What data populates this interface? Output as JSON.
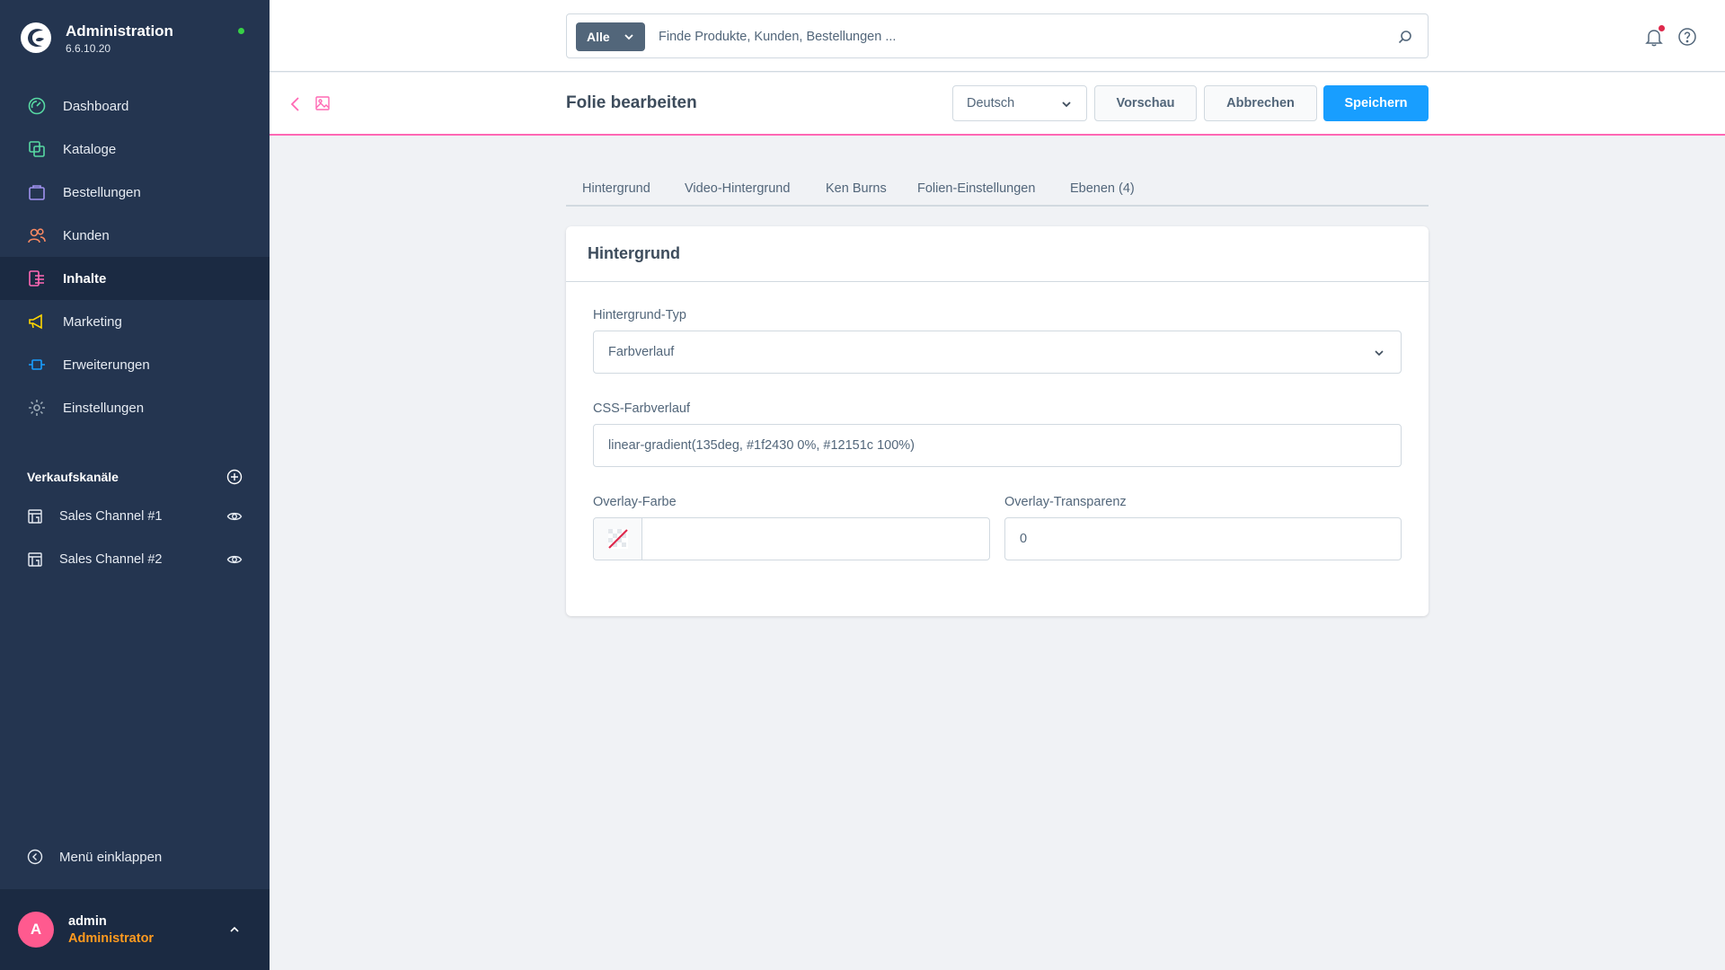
{
  "brand": {
    "title": "Administration",
    "version": "6.6.10.20",
    "status_color": "#37d046"
  },
  "sidebar": {
    "items": [
      {
        "label": "Dashboard",
        "icon": "dashboard-icon",
        "color": "#57d9a3"
      },
      {
        "label": "Kataloge",
        "icon": "catalog-icon",
        "color": "#57d9a3"
      },
      {
        "label": "Bestellungen",
        "icon": "orders-icon",
        "color": "#a092f0"
      },
      {
        "label": "Kunden",
        "icon": "customers-icon",
        "color": "#f88962"
      },
      {
        "label": "Inhalte",
        "icon": "content-icon",
        "color": "#ff68b4",
        "active": true
      },
      {
        "label": "Marketing",
        "icon": "marketing-icon",
        "color": "#ffd700"
      },
      {
        "label": "Erweiterungen",
        "icon": "extensions-icon",
        "color": "#189eff"
      },
      {
        "label": "Einstellungen",
        "icon": "settings-icon",
        "color": "#9aa8b5"
      }
    ],
    "channels_title": "Verkaufskanäle",
    "channels": [
      {
        "label": "Sales Channel #1"
      },
      {
        "label": "Sales Channel #2"
      }
    ],
    "collapse_label": "Menü einklappen"
  },
  "user": {
    "initial": "A",
    "name": "admin",
    "role": "Administrator"
  },
  "search": {
    "type_label": "Alle",
    "placeholder": "Finde Produkte, Kunden, Bestellungen ..."
  },
  "smartbar": {
    "title": "Folie bearbeiten",
    "language": "Deutsch",
    "preview_label": "Vorschau",
    "cancel_label": "Abbrechen",
    "save_label": "Speichern"
  },
  "tabs": [
    {
      "label": "Hintergrund",
      "active": true
    },
    {
      "label": "Video-Hintergrund"
    },
    {
      "label": "Ken Burns"
    },
    {
      "label": "Folien-Einstellungen"
    },
    {
      "label": "Ebenen (4)"
    }
  ],
  "card": {
    "title": "Hintergrund",
    "background_type_label": "Hintergrund-Typ",
    "background_type_value": "Farbverlauf",
    "css_gradient_label": "CSS-Farbverlauf",
    "css_gradient_value": "linear-gradient(135deg, #1f2430 0%, #12151c 100%)",
    "overlay_color_label": "Overlay-Farbe",
    "overlay_color_value": "",
    "overlay_opacity_label": "Overlay-Transparenz",
    "overlay_opacity_value": "0"
  },
  "colors": {
    "primary": "#189eff",
    "sidebar_bg": "#243550",
    "accent_pink": "#ff68b4",
    "role_orange": "#ff9a1f"
  }
}
